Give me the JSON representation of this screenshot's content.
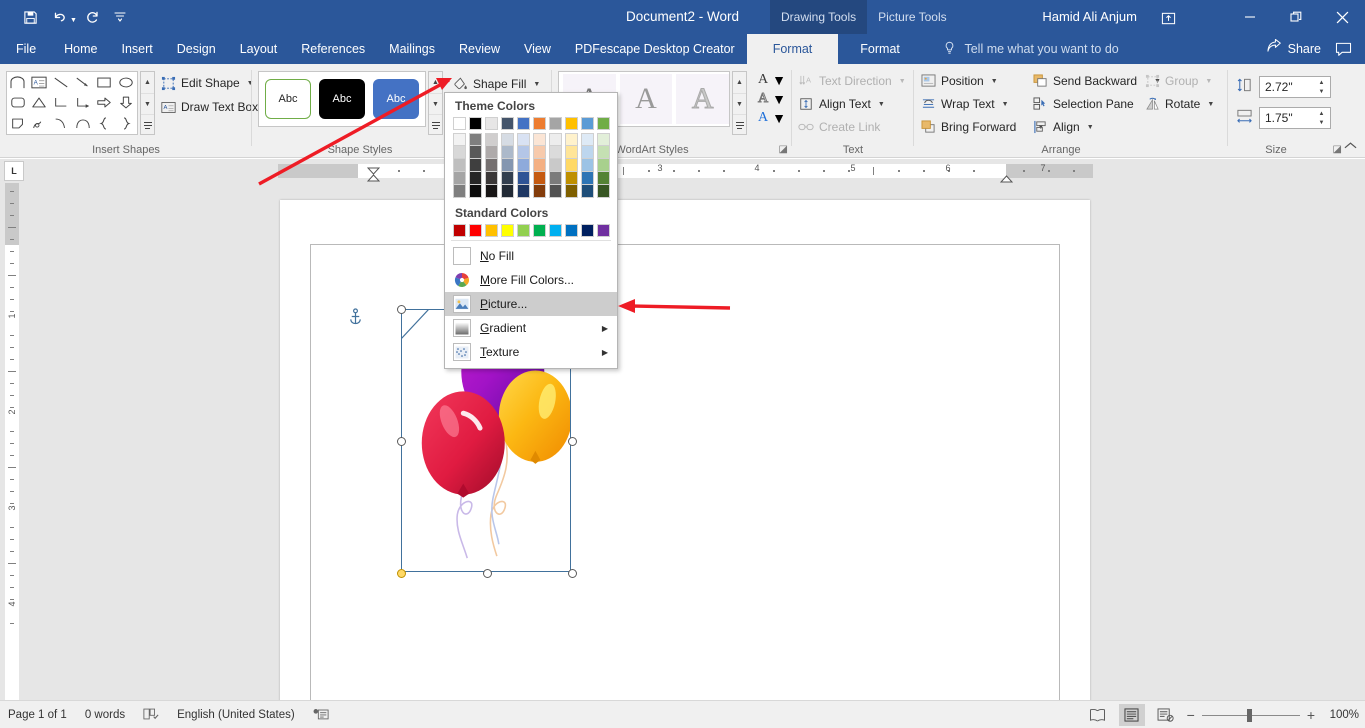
{
  "titlebar": {
    "document_title": "Document2  -  Word",
    "user_name": "Hamid Ali Anjum",
    "qat": [
      {
        "name": "save-icon",
        "label": "Save"
      },
      {
        "name": "undo-icon",
        "label": "Undo"
      },
      {
        "name": "redo-icon",
        "label": "Redo"
      },
      {
        "name": "customize-qat-icon",
        "label": "Customize Quick Access Toolbar"
      }
    ],
    "context_tabs": [
      {
        "label": "Drawing Tools",
        "active": true
      },
      {
        "label": "Picture Tools",
        "active": false
      }
    ],
    "window_buttons": [
      {
        "name": "ribbon-display-options",
        "glyph": "⌷"
      },
      {
        "name": "minimize-button",
        "glyph": "─"
      },
      {
        "name": "restore-button",
        "glyph": "❐"
      },
      {
        "name": "close-button",
        "glyph": "✕"
      }
    ]
  },
  "tabs": {
    "items": [
      {
        "label": "File",
        "active": false
      },
      {
        "label": "Home",
        "active": false
      },
      {
        "label": "Insert",
        "active": false
      },
      {
        "label": "Design",
        "active": false
      },
      {
        "label": "Layout",
        "active": false
      },
      {
        "label": "References",
        "active": false
      },
      {
        "label": "Mailings",
        "active": false
      },
      {
        "label": "Review",
        "active": false
      },
      {
        "label": "View",
        "active": false
      },
      {
        "label": "PDFescape Desktop Creator",
        "active": false
      },
      {
        "label": "Format",
        "active": true
      },
      {
        "label": "Format",
        "active": false
      }
    ],
    "tell_me": "Tell me what you want to do",
    "share": "Share"
  },
  "ribbon": {
    "groups": [
      {
        "name": "insert-shapes",
        "label": "Insert Shapes"
      },
      {
        "name": "shape-styles",
        "label": "Shape Styles"
      },
      {
        "name": "wordart-styles",
        "label": "WordArt Styles"
      },
      {
        "name": "text",
        "label": "Text"
      },
      {
        "name": "arrange",
        "label": "Arrange"
      },
      {
        "name": "size",
        "label": "Size"
      }
    ],
    "insert_shapes": {
      "edit_shape": "Edit Shape",
      "draw_text_box": "Draw Text Box"
    },
    "shape_styles": {
      "shape_fill": "Shape Fill",
      "chips": [
        "Abc",
        "Abc",
        "Abc"
      ]
    },
    "text_group": {
      "text_direction": "Text Direction",
      "align_text": "Align Text",
      "create_link": "Create Link"
    },
    "arrange_group": {
      "position": "Position",
      "wrap_text": "Wrap Text",
      "bring_forward": "Bring Forward",
      "send_backward": "Send Backward",
      "selection_pane": "Selection Pane",
      "group": "Group",
      "rotate": "Rotate",
      "align": "Align"
    },
    "size_group": {
      "height_value": "2.72\"",
      "width_value": "1.75\"",
      "height_label": "Shape Height",
      "width_label": "Shape Width"
    }
  },
  "fill_menu": {
    "theme_colors_label": "Theme Colors",
    "standard_colors_label": "Standard Colors",
    "theme_colors": [
      [
        "#ffffff",
        "#f2f2f2",
        "#d8d8d8",
        "#bfbfbf",
        "#a5a5a5",
        "#7f7f7f"
      ],
      [
        "#000000",
        "#7f7f7f",
        "#595959",
        "#3f3f3f",
        "#262626",
        "#0c0c0c"
      ],
      [
        "#e7e6e6",
        "#d0cece",
        "#aeaaaa",
        "#757070",
        "#3b3838",
        "#181616"
      ],
      [
        "#44546a",
        "#d6dce4",
        "#acb9ca",
        "#8496b0",
        "#333f4f",
        "#222a35"
      ],
      [
        "#4472c4",
        "#d9e2f3",
        "#b4c6e7",
        "#8eaadb",
        "#2f5496",
        "#1f3864"
      ],
      [
        "#ed7d31",
        "#fbe5d5",
        "#f7caac",
        "#f4b083",
        "#c55a11",
        "#833c0b"
      ],
      [
        "#a5a5a5",
        "#ededed",
        "#dbdbdb",
        "#c9c9c9",
        "#7b7b7b",
        "#525252"
      ],
      [
        "#ffc000",
        "#fff2cc",
        "#ffe598",
        "#ffd965",
        "#bf9000",
        "#7f6000"
      ],
      [
        "#5b9bd5",
        "#deeaf6",
        "#bdd6ee",
        "#9cc3e5",
        "#2e75b5",
        "#1f4e79"
      ],
      [
        "#70ad47",
        "#e2efd9",
        "#c5e0b3",
        "#a8d08d",
        "#548235",
        "#375623"
      ]
    ],
    "standard_colors": [
      "#c00000",
      "#ff0000",
      "#ffc000",
      "#ffff00",
      "#92d050",
      "#00b050",
      "#00b0f0",
      "#0070c0",
      "#002060",
      "#7030a0"
    ],
    "items": [
      {
        "name": "no-fill",
        "label": "No Fill",
        "accel": "N",
        "icon": "empty-square-icon",
        "submenu": false,
        "selected": false
      },
      {
        "name": "more-fill-colors",
        "label": "More Fill Colors...",
        "accel": "M",
        "icon": "color-wheel-icon",
        "submenu": false,
        "selected": false
      },
      {
        "name": "picture-fill",
        "label": "Picture...",
        "accel": "P",
        "icon": "picture-icon",
        "submenu": false,
        "selected": true
      },
      {
        "name": "gradient-fill",
        "label": "Gradient",
        "accel": "G",
        "icon": "gradient-icon",
        "submenu": true,
        "selected": false
      },
      {
        "name": "texture-fill",
        "label": "Texture",
        "accel": "T",
        "icon": "texture-icon",
        "submenu": true,
        "selected": false
      }
    ]
  },
  "ruler": {
    "h_numbers": [
      "3",
      "4",
      "5",
      "6",
      "7"
    ],
    "v_numbers": [
      "1",
      "2",
      "3",
      "4"
    ],
    "tab_stop_type": "L"
  },
  "document": {
    "image_alt": "Colorful balloons clipart",
    "selection_handles": 8
  },
  "statusbar": {
    "page_info": "Page 1 of 1",
    "word_count": "0 words",
    "proofing_icon": "proofing-errors-icon",
    "language": "English (United States)",
    "macro_icon": "macro-record-icon",
    "views": [
      {
        "name": "read-mode-view",
        "active": false
      },
      {
        "name": "print-layout-view",
        "active": true
      },
      {
        "name": "web-layout-view",
        "active": false
      }
    ],
    "zoom_out": "−",
    "zoom_in": "+",
    "zoom_level": "100%"
  },
  "colors": {
    "word_blue": "#2b579a",
    "ribbon_bg": "#f0f0f0",
    "accent": "#4472c4",
    "annotation_arrow": "#ee1c25"
  }
}
